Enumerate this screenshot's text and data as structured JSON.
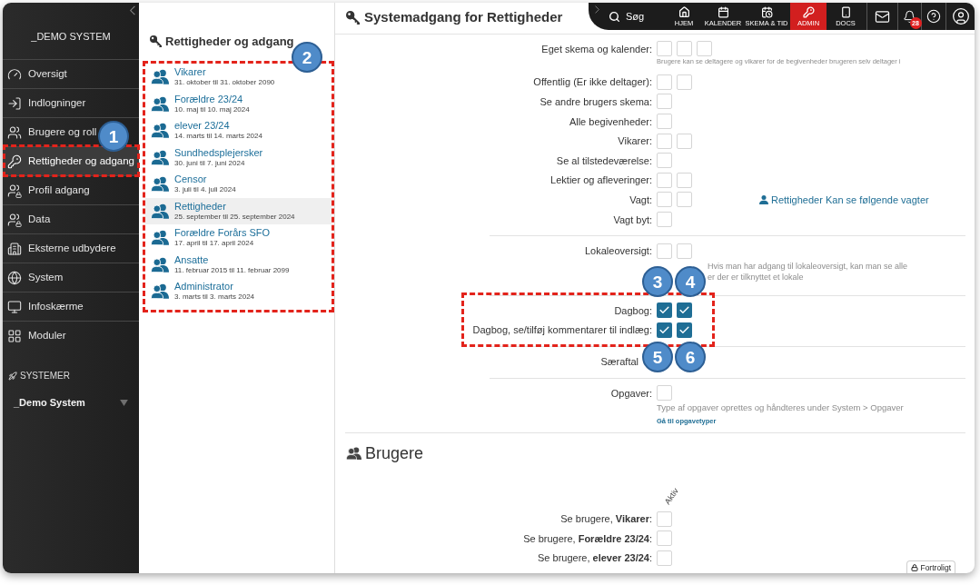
{
  "sidebar": {
    "title": "_DEMO SYSTEM",
    "items": [
      {
        "label": "Oversigt",
        "selected": false
      },
      {
        "label": "Indlogninger",
        "selected": false
      },
      {
        "label": "Brugere og roll",
        "selected": false
      },
      {
        "label": "Rettigheder og adgang",
        "selected": true
      },
      {
        "label": "Profil adgang",
        "selected": false
      },
      {
        "label": "Data",
        "selected": false
      },
      {
        "label": "Eksterne udbydere",
        "selected": false
      },
      {
        "label": "System",
        "selected": false
      },
      {
        "label": "Infoskærme",
        "selected": false
      },
      {
        "label": "Moduler",
        "selected": false
      }
    ],
    "systems_heading": "SYSTEMER",
    "system_selector": {
      "value": "_Demo System"
    }
  },
  "roles_panel": {
    "title": "Rettigheder og adgang",
    "roles": [
      {
        "name": "Vikarer",
        "period": "31. oktober til 31. oktober 2090",
        "selected": false
      },
      {
        "name": "Forældre 23/24",
        "period": "10. maj til 10. maj 2024",
        "selected": false
      },
      {
        "name": "elever 23/24",
        "period": "14. marts til 14. marts 2024",
        "selected": false
      },
      {
        "name": "Sundhedsplejersker",
        "period": "30. juni til 7. juni 2024",
        "selected": false
      },
      {
        "name": "Censor",
        "period": "3. juli til 4. juli 2024",
        "selected": false
      },
      {
        "name": "Rettigheder",
        "period": "25. september til 25. september 2024",
        "selected": true
      },
      {
        "name": "Forældre Forårs SFO",
        "period": "17. april til 17. april 2024",
        "selected": false
      },
      {
        "name": "Ansatte",
        "period": "11. februar 2015 til 11. februar 2099",
        "selected": false
      },
      {
        "name": "Administrator",
        "period": "3. marts til 3. marts 2024",
        "selected": false
      }
    ]
  },
  "header": {
    "title": "Systemadgang for Rettigheder",
    "search": {
      "label": "Søg"
    },
    "nav": [
      {
        "label": "HJEM",
        "selected": false
      },
      {
        "label": "KALENDER",
        "selected": false
      },
      {
        "label": "SKEMA & TID",
        "selected": false
      },
      {
        "label": "ADMIN",
        "selected": true
      },
      {
        "label": "DOCS",
        "selected": false
      }
    ],
    "notification_count": "28"
  },
  "permission_groups": [
    {
      "rows": [
        {
          "kind": "setting",
          "label": "Eget skema og kalender:",
          "checkboxes": [
            {
              "checked": false
            },
            {
              "checked": false
            },
            {
              "checked": false
            }
          ],
          "note": {
            "kind": "fine",
            "lines": [
              "Brugere kan se deltagere og vikarer for de begivenheder brugeren selv deltager i"
            ]
          }
        },
        {
          "kind": "setting",
          "label": "Offentlig (Er ikke deltager):",
          "checkboxes": [
            {
              "checked": false
            },
            {
              "checked": false
            }
          ]
        },
        {
          "kind": "setting",
          "label": "Se andre brugers skema:",
          "checkboxes": [
            {
              "checked": false
            }
          ]
        },
        {
          "kind": "setting",
          "label": "Alle begivenheder:",
          "checkboxes": [
            {
              "checked": false
            }
          ]
        },
        {
          "kind": "setting",
          "label": "Vikarer:",
          "checkboxes": [
            {
              "checked": false
            },
            {
              "checked": false
            }
          ]
        },
        {
          "kind": "setting",
          "label": "Se al tilstedeværelse:",
          "checkboxes": [
            {
              "checked": false
            }
          ]
        },
        {
          "kind": "setting",
          "label": "Lektier og afleveringer:",
          "checkboxes": [
            {
              "checked": false
            },
            {
              "checked": false
            }
          ]
        },
        {
          "kind": "setting",
          "label": "Vagt:",
          "checkboxes": [
            {
              "checked": false
            },
            {
              "checked": false
            }
          ],
          "side_link": "Rettigheder Kan se følgende vagter"
        },
        {
          "kind": "setting",
          "label": "Vagt byt:",
          "checkboxes": [
            {
              "checked": false
            }
          ]
        }
      ]
    },
    {
      "rows": [
        {
          "kind": "setting",
          "label": "Lokaleoversigt:",
          "checkboxes": [
            {
              "checked": false
            },
            {
              "checked": false
            }
          ],
          "note": {
            "kind": "covered",
            "lines": [
              "Hvis man har adgang til lokaleoversigt, kan man se alle",
              "er der er tilknyttet et lokale"
            ]
          }
        }
      ]
    },
    {
      "rows": [
        {
          "kind": "setting",
          "label": "Dagbog:",
          "checkboxes": [
            {
              "checked": true
            },
            {
              "checked": true
            }
          ]
        },
        {
          "kind": "setting",
          "label": "Dagbog, se/tilføj kommentarer til indlæg:",
          "checkboxes": [
            {
              "checked": true
            },
            {
              "checked": true
            }
          ]
        }
      ]
    },
    {
      "rows": [
        {
          "kind": "obscured",
          "label": "Særaftal"
        }
      ]
    },
    {
      "rows": [
        {
          "kind": "setting",
          "label": "Opgaver:",
          "checkboxes": [
            {
              "checked": false
            }
          ],
          "note": {
            "kind": "regular",
            "lines": [
              "Type af opgaver oprettes og håndteres under System > Opgaver"
            ],
            "link": "Gå til opgavetyper"
          }
        }
      ]
    }
  ],
  "users_section": {
    "title": "Brugere",
    "column_header": "Aktiv",
    "rows": [
      {
        "label": "Se brugere, **Vikarer**:",
        "checked": false
      },
      {
        "label": "Se brugere, **Forældre 23/24**:",
        "checked": false
      },
      {
        "label": "Se brugere, **elever 23/24**:",
        "checked": false
      }
    ]
  },
  "confidential_label": "Fortroligt",
  "callouts": [
    {
      "label": "1"
    },
    {
      "label": "2"
    },
    {
      "label": "3"
    },
    {
      "label": "4"
    },
    {
      "label": "5"
    },
    {
      "label": "6"
    }
  ]
}
